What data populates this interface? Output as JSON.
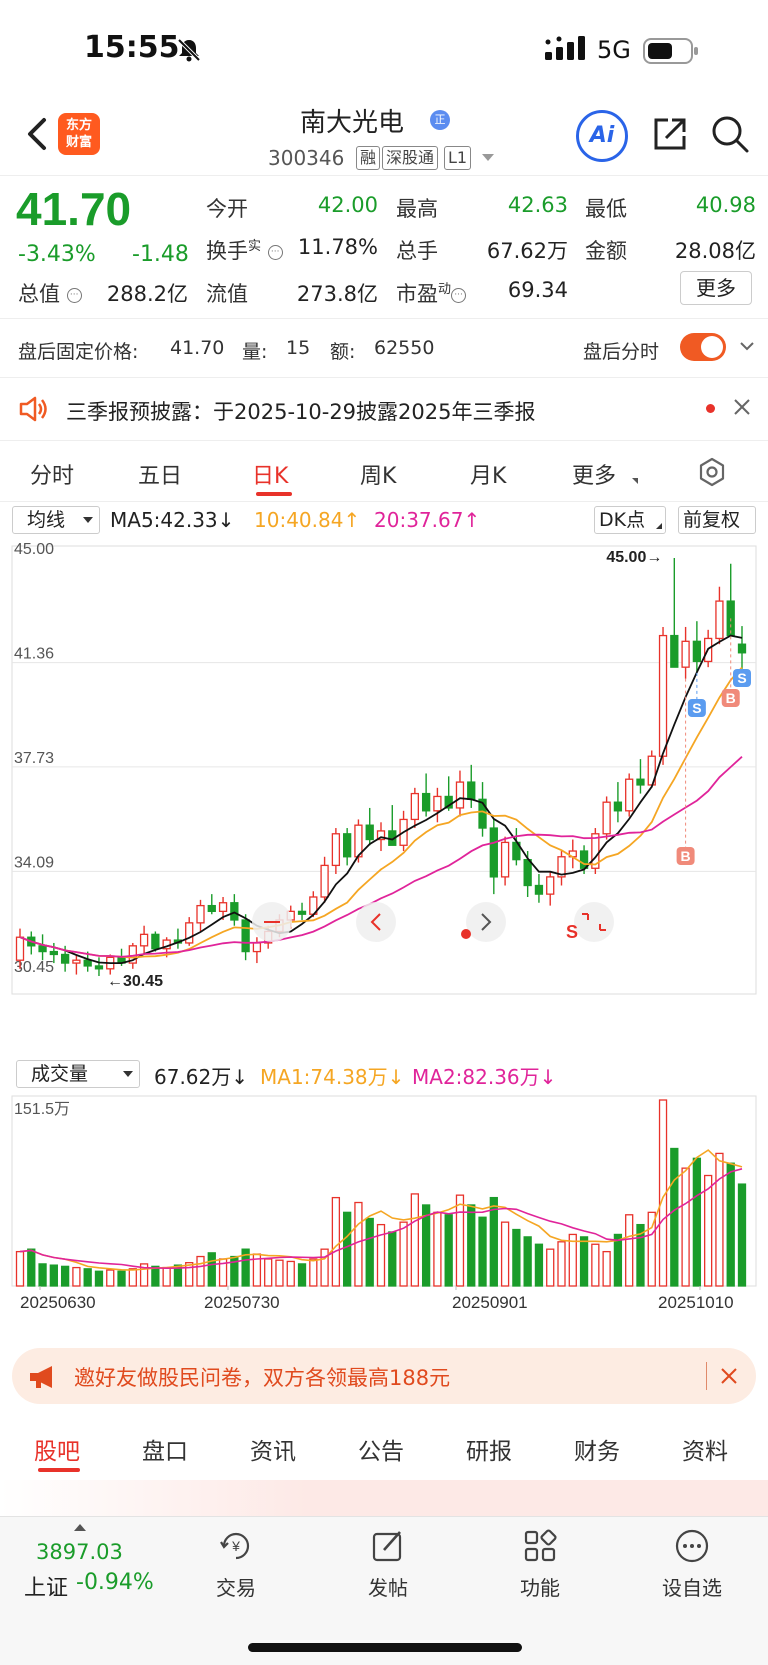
{
  "status": {
    "time": "15:55",
    "network": "5G"
  },
  "header": {
    "logo_text": "东方财富",
    "stock_name": "南大光电",
    "name_badge": "正",
    "code": "300346",
    "tags": [
      "融",
      "深股通",
      "L1"
    ],
    "ai_label": "Ai"
  },
  "quote": {
    "price": "41.70",
    "change_pct": "-3.43%",
    "change_abs": "-1.48",
    "fields": [
      {
        "label": "今开",
        "value": "42.00"
      },
      {
        "label": "最高",
        "value": "42.63"
      },
      {
        "label": "最低",
        "value": "40.98"
      },
      {
        "label": "换手",
        "sup": "实",
        "value": "11.78%"
      },
      {
        "label": "总手",
        "value": "67.62万"
      },
      {
        "label": "金额",
        "value": "28.08亿"
      },
      {
        "label": "总值",
        "value": "288.2亿"
      },
      {
        "label": "流值",
        "value": "273.8亿"
      },
      {
        "label": "市盈",
        "sup": "动",
        "value": "69.34"
      }
    ],
    "more_label": "更多"
  },
  "after_hours": {
    "label": "盘后固定价格:",
    "price": "41.70",
    "vol_label": "量:",
    "vol": "15",
    "amt_label": "额:",
    "amt": "62550",
    "toggle_label": "盘后分时"
  },
  "notice": {
    "text": "三季报预披露：于2025-10-29披露2025年三季报"
  },
  "tabs": [
    {
      "label": "分时"
    },
    {
      "label": "五日"
    },
    {
      "label": "日K"
    },
    {
      "label": "周K"
    },
    {
      "label": "月K"
    },
    {
      "label": "更多"
    }
  ],
  "ma_row": {
    "selector": "均线",
    "ma5": "MA5:42.33↓",
    "ma10": "10:40.84↑",
    "ma20": "20:37.67↑",
    "dk_label": "DK点",
    "adjust_label": "前复权"
  },
  "chart_data": [
    {
      "type": "candlestick",
      "title": "",
      "y_ticks": [
        "45.00",
        "41.36",
        "37.73",
        "34.09",
        "30.45"
      ],
      "ylim": [
        30.45,
        45.0
      ],
      "annotations": [
        "45.00→",
        "←30.45"
      ],
      "signal_markers": [
        "B",
        "S",
        "B",
        "S"
      ],
      "nav_controls": [
        "S"
      ],
      "colors": {
        "up": "#e8322a",
        "down": "#1a9c2a",
        "ma5": "#111111",
        "ma10": "#f5a623",
        "ma20": "#e0249a"
      },
      "candles": [
        [
          31.0,
          32.1,
          30.7,
          31.8
        ],
        [
          31.8,
          32.0,
          31.2,
          31.5
        ],
        [
          31.5,
          31.9,
          31.0,
          31.3
        ],
        [
          31.3,
          31.6,
          30.9,
          31.2
        ],
        [
          31.2,
          31.5,
          30.6,
          30.9
        ],
        [
          30.9,
          31.2,
          30.5,
          31.0
        ],
        [
          31.0,
          31.3,
          30.6,
          30.8
        ],
        [
          30.8,
          31.1,
          30.45,
          30.7
        ],
        [
          30.7,
          31.2,
          30.5,
          31.1
        ],
        [
          31.1,
          31.4,
          30.8,
          30.9
        ],
        [
          30.9,
          31.6,
          30.7,
          31.5
        ],
        [
          31.5,
          32.2,
          31.2,
          31.9
        ],
        [
          31.9,
          32.0,
          31.3,
          31.4
        ],
        [
          31.4,
          31.8,
          31.1,
          31.7
        ],
        [
          31.7,
          32.1,
          31.4,
          31.6
        ],
        [
          31.6,
          32.5,
          31.5,
          32.3
        ],
        [
          32.3,
          33.1,
          32.0,
          32.9
        ],
        [
          32.9,
          33.3,
          32.6,
          32.7
        ],
        [
          32.7,
          33.2,
          32.4,
          33.0
        ],
        [
          33.0,
          33.3,
          32.2,
          32.4
        ],
        [
          32.4,
          32.6,
          31.0,
          31.3
        ],
        [
          31.3,
          31.8,
          30.9,
          31.6
        ],
        [
          31.6,
          32.2,
          31.4,
          32.0
        ],
        [
          32.0,
          32.6,
          31.8,
          32.4
        ],
        [
          32.4,
          32.9,
          32.1,
          32.7
        ],
        [
          32.7,
          33.0,
          32.4,
          32.6
        ],
        [
          32.6,
          33.4,
          32.5,
          33.2
        ],
        [
          33.2,
          34.6,
          33.0,
          34.3
        ],
        [
          34.3,
          35.6,
          34.0,
          35.4
        ],
        [
          35.4,
          35.6,
          34.3,
          34.6
        ],
        [
          34.6,
          35.9,
          34.4,
          35.7
        ],
        [
          35.7,
          36.3,
          35.0,
          35.2
        ],
        [
          35.2,
          35.8,
          34.8,
          35.5
        ],
        [
          35.5,
          36.4,
          35.1,
          35.0
        ],
        [
          35.0,
          36.2,
          34.8,
          35.9
        ],
        [
          35.9,
          37.0,
          35.6,
          36.8
        ],
        [
          36.8,
          37.5,
          36.0,
          36.2
        ],
        [
          36.2,
          37.0,
          35.8,
          36.7
        ],
        [
          36.7,
          37.4,
          36.2,
          36.3
        ],
        [
          36.3,
          37.6,
          36.0,
          37.2
        ],
        [
          37.2,
          37.8,
          36.3,
          36.6
        ],
        [
          36.6,
          37.2,
          35.3,
          35.6
        ],
        [
          35.6,
          35.9,
          33.3,
          33.9
        ],
        [
          33.9,
          35.3,
          33.6,
          35.1
        ],
        [
          35.1,
          35.6,
          34.3,
          34.5
        ],
        [
          34.5,
          34.8,
          33.2,
          33.6
        ],
        [
          33.6,
          34.0,
          33.0,
          33.3
        ],
        [
          33.3,
          34.1,
          32.9,
          33.9
        ],
        [
          33.9,
          34.8,
          33.6,
          34.6
        ],
        [
          34.6,
          35.2,
          34.2,
          34.8
        ],
        [
          34.8,
          35.0,
          34.0,
          34.2
        ],
        [
          34.2,
          35.6,
          34.0,
          35.4
        ],
        [
          35.4,
          36.7,
          35.2,
          36.5
        ],
        [
          36.5,
          37.2,
          35.8,
          36.2
        ],
        [
          36.2,
          37.5,
          36.0,
          37.3
        ],
        [
          37.3,
          38.0,
          36.8,
          37.1
        ],
        [
          37.1,
          38.3,
          37.0,
          38.1
        ],
        [
          38.1,
          42.6,
          37.8,
          42.3
        ],
        [
          42.3,
          45.0,
          41.6,
          41.2
        ],
        [
          41.2,
          42.6,
          40.8,
          42.1
        ],
        [
          42.1,
          42.8,
          41.0,
          41.4
        ],
        [
          41.4,
          42.5,
          41.2,
          42.2
        ],
        [
          42.2,
          44.0,
          42.0,
          43.5
        ],
        [
          43.5,
          44.8,
          42.9,
          42.3
        ],
        [
          42.0,
          42.63,
          40.98,
          41.7
        ]
      ],
      "x_labels": [
        "20250630",
        "20250730",
        "20250901",
        "20251010"
      ]
    },
    {
      "type": "bar",
      "title": "成交量",
      "y_ticks": [
        "151.5万"
      ],
      "ylim": [
        0,
        151.5
      ],
      "legend": {
        "selector": "成交量",
        "value": "67.62万↓",
        "ma1": "MA1:74.38万↓",
        "ma2": "MA2:82.36万↓"
      },
      "values": [
        28,
        30,
        18,
        17,
        16,
        15,
        14,
        12,
        13,
        12,
        14,
        18,
        16,
        15,
        17,
        19,
        24,
        27,
        22,
        24,
        30,
        26,
        22,
        21,
        20,
        18,
        22,
        30,
        72,
        60,
        68,
        55,
        50,
        44,
        52,
        75,
        66,
        60,
        58,
        74,
        66,
        56,
        72,
        52,
        46,
        40,
        34,
        30,
        36,
        42,
        40,
        34,
        28,
        42,
        58,
        50,
        60,
        151.5,
        112,
        96,
        104,
        90,
        108,
        100,
        83
      ],
      "x_labels": [
        "20250630",
        "20250730",
        "20250901",
        "20251010"
      ]
    }
  ],
  "banner": {
    "text": "邀好友做股民问卷，双方各领最高188元"
  },
  "bottom_tabs": [
    {
      "label": "股吧"
    },
    {
      "label": "盘口"
    },
    {
      "label": "资讯"
    },
    {
      "label": "公告"
    },
    {
      "label": "研报"
    },
    {
      "label": "财务"
    },
    {
      "label": "资料"
    }
  ],
  "bottom_nav": {
    "index_value": "3897.03",
    "index_name": "上证",
    "index_change": "-0.94%",
    "items": [
      {
        "label": "交易"
      },
      {
        "label": "发帖"
      },
      {
        "label": "功能"
      },
      {
        "label": "设自选"
      }
    ]
  }
}
